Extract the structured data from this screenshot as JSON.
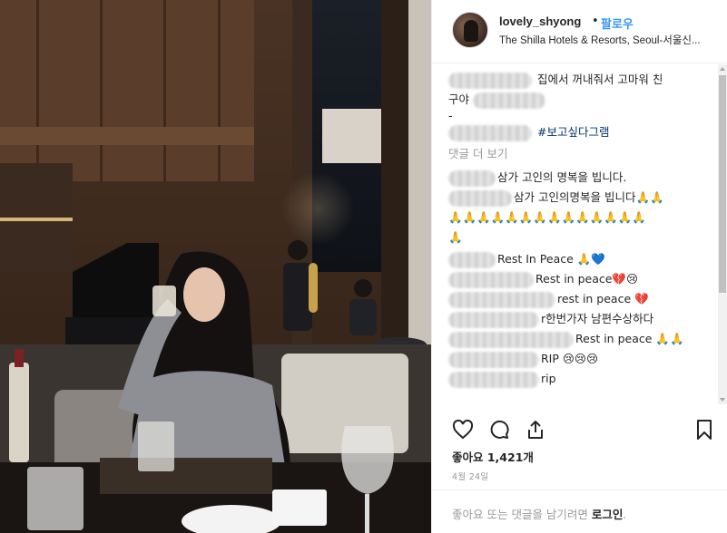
{
  "post": {
    "username": "lovely_shyong",
    "separator": "•",
    "follow_label": "팔로우",
    "location": "The Shilla Hotels & Resorts, Seoul-서울신...",
    "avatar_icon": "profile-avatar",
    "caption": {
      "line1": "집에서 꺼내줘서 고마워 친",
      "line2": "구야",
      "line3": "-",
      "hashtag": "#보고싶다그램"
    },
    "view_more_comments": "댓글 더 보기",
    "comments": [
      {
        "text": "삼가 고인의 명복을 빕니다."
      },
      {
        "text": "삼가 고인의명복을 빕니다🙏🙏"
      },
      {
        "text": "🙏🙏🙏🙏🙏🙏🙏🙏🙏🙏🙏🙏🙏🙏"
      },
      {
        "text": "🙏"
      },
      {
        "text": "Rest In Peace 🙏💙"
      },
      {
        "text": "Rest in peace💔😢"
      },
      {
        "text": "rest in peace 💔"
      },
      {
        "text": "r한번가자 남편수상하다"
      },
      {
        "text": "Rest in peace 🙏🙏"
      },
      {
        "text": "RIP 😢😢😢"
      },
      {
        "text": "rip"
      }
    ],
    "actions": {
      "like_icon": "heart-icon",
      "comment_icon": "comment-icon",
      "share_icon": "share-icon",
      "save_icon": "bookmark-icon"
    },
    "likes_text": "좋아요 1,421개",
    "date": "4월 24일",
    "login_prompt": "좋아요 또는 댓글을 남기려면",
    "login_link": "로그인",
    "login_suffix": "."
  },
  "colors": {
    "link": "#003569",
    "follow": "#3897f0",
    "muted": "#999999",
    "text": "#262626",
    "heart_blue": "#3d8ef8",
    "heart_red": "#e0245e"
  }
}
